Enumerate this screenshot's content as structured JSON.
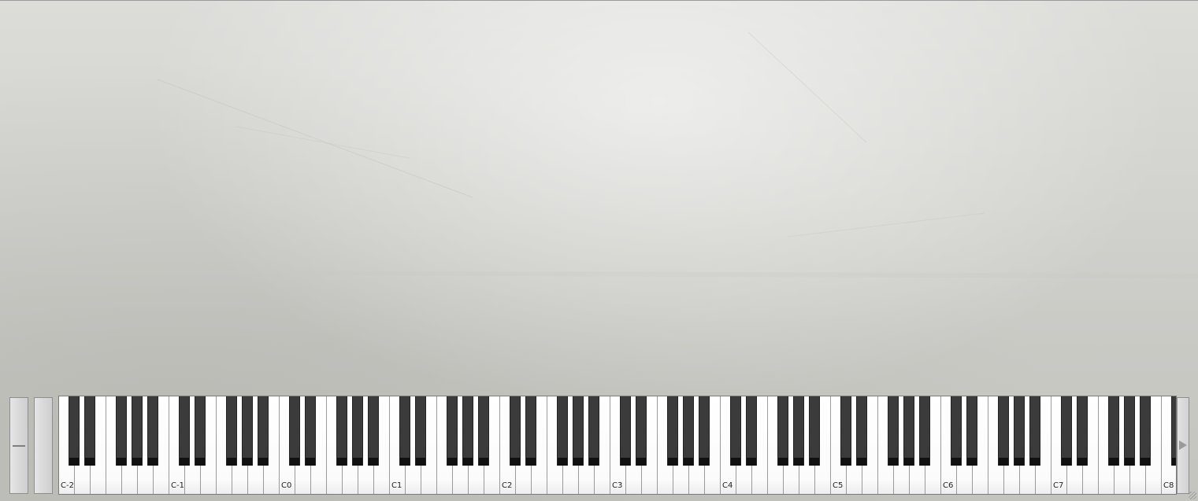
{
  "keyboard": {
    "octave_labels": [
      "C-2",
      "C-1",
      "C0",
      "C1",
      "C2",
      "C3",
      "C4",
      "C5",
      "C6",
      "C7",
      "C8"
    ]
  },
  "icons": {
    "scroll_right": "triangle-right-icon",
    "resize_grip": "resize-grip-icon"
  },
  "colors": {
    "background": "#d4d4d0",
    "white_key": "#ffffff",
    "black_key": "#3b3b3b"
  }
}
